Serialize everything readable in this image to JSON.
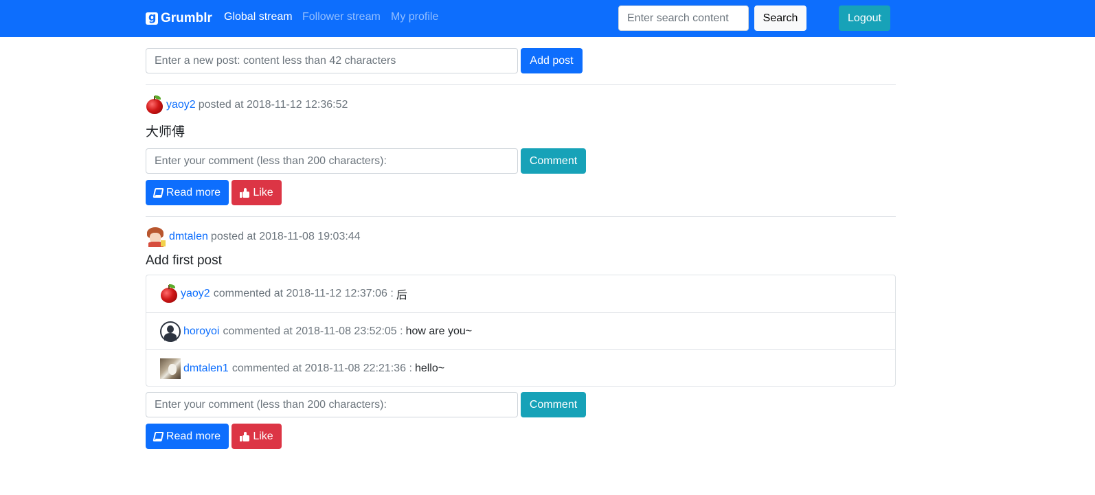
{
  "nav": {
    "brand": "Grumblr",
    "links": [
      {
        "label": "Global stream",
        "active": true
      },
      {
        "label": "Follower stream",
        "active": false
      },
      {
        "label": "My profile",
        "active": false
      }
    ],
    "search_placeholder": "Enter search content",
    "search_label": "Search",
    "logout_label": "Logout"
  },
  "new_post": {
    "placeholder": "Enter a new post: content less than 42 characters",
    "button_label": "Add post"
  },
  "posts": [
    {
      "username": "yaoy2",
      "meta": "posted at 2018-11-12 12:36:52",
      "content": "大师傅",
      "avatar": "apple",
      "comments": [],
      "comment_placeholder": "Enter your comment (less than 200 characters):",
      "comment_label": "Comment",
      "read_more_label": "Read more",
      "like_label": "Like"
    },
    {
      "username": "dmtalen",
      "meta": "posted at 2018-11-08 19:03:44",
      "content": "Add first post",
      "avatar": "anime",
      "comments": [
        {
          "username": "yaoy2",
          "meta": "commented at 2018-11-12 12:37:06 :",
          "text": "后",
          "avatar": "apple"
        },
        {
          "username": "horoyoi",
          "meta": "commented at 2018-11-08 23:52:05 :",
          "text": "how are you~",
          "avatar": "person"
        },
        {
          "username": "dmtalen1",
          "meta": "commented at 2018-11-08 22:21:36 :",
          "text": "hello~",
          "avatar": "photo"
        }
      ],
      "comment_placeholder": "Enter your comment (less than 200 characters):",
      "comment_label": "Comment",
      "read_more_label": "Read more",
      "like_label": "Like"
    }
  ],
  "colors": {
    "navbar": "#0d6efd",
    "link": "#0d6efd",
    "info": "#17a2b8",
    "danger": "#dc3545",
    "muted": "#6c757d"
  },
  "icons": {
    "read_more": "book-icon",
    "like": "thumbs-up-icon"
  }
}
